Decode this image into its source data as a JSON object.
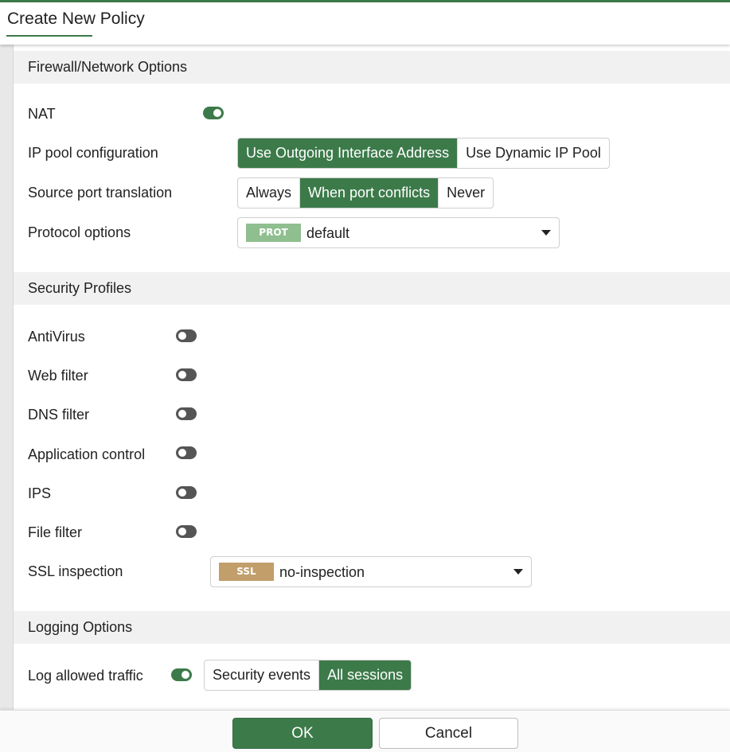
{
  "header": {
    "title": "Create New Policy"
  },
  "firewall": {
    "section_title": "Firewall/Network Options",
    "nat": {
      "label": "NAT",
      "enabled": true
    },
    "ip_pool": {
      "label": "IP pool configuration",
      "options": [
        "Use Outgoing Interface Address",
        "Use Dynamic IP Pool"
      ],
      "selected": "Use Outgoing Interface Address"
    },
    "source_port": {
      "label": "Source port translation",
      "options": [
        "Always",
        "When port conflicts",
        "Never"
      ],
      "selected": "When port conflicts"
    },
    "protocol": {
      "label": "Protocol options",
      "badge": "PROT",
      "value": "default",
      "badge_color": "#8fbf8f"
    }
  },
  "security": {
    "section_title": "Security Profiles",
    "profiles": [
      {
        "label": "AntiVirus",
        "enabled": false
      },
      {
        "label": "Web filter",
        "enabled": false
      },
      {
        "label": "DNS filter",
        "enabled": false
      },
      {
        "label": "Application control",
        "enabled": false
      },
      {
        "label": "IPS",
        "enabled": false
      },
      {
        "label": "File filter",
        "enabled": false
      }
    ],
    "ssl": {
      "label": "SSL inspection",
      "badge": "SSL",
      "value": "no-inspection",
      "badge_color": "#c29e6b"
    }
  },
  "logging": {
    "section_title": "Logging Options",
    "log_allowed": {
      "label": "Log allowed traffic",
      "enabled": true
    },
    "options": [
      "Security events",
      "All sessions"
    ],
    "selected": "All sessions"
  },
  "footer": {
    "ok_label": "OK",
    "cancel_label": "Cancel"
  },
  "colors": {
    "accent": "#3c7a4a",
    "toggle_off": "#555555"
  }
}
